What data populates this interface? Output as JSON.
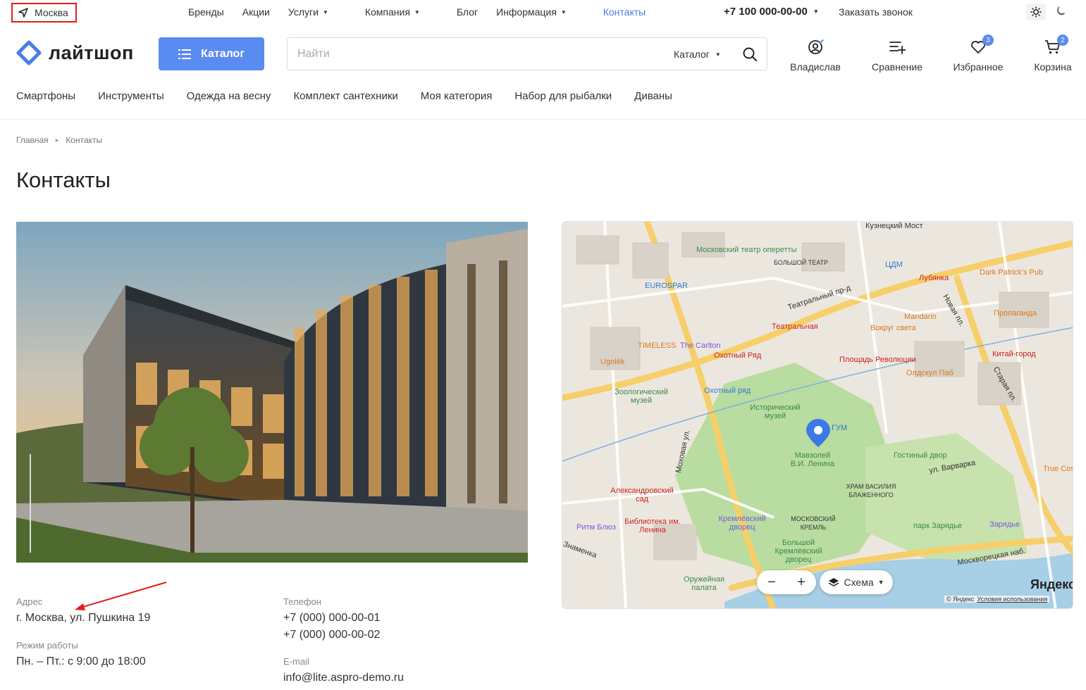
{
  "topbar": {
    "city": "Москва",
    "nav": [
      {
        "label": "Бренды",
        "dropdown": false
      },
      {
        "label": "Акции",
        "dropdown": false
      },
      {
        "label": "Услуги",
        "dropdown": true
      },
      {
        "label": "Компания",
        "dropdown": true
      },
      {
        "label": "Блог",
        "dropdown": false
      },
      {
        "label": "Информация",
        "dropdown": true
      },
      {
        "label": "Контакты",
        "dropdown": false,
        "active": true
      }
    ],
    "phone": "+7 100 000-00-00",
    "callback": "Заказать звонок"
  },
  "header": {
    "logo_text": "лайтшоп",
    "catalog_label": "Каталог",
    "search_placeholder": "Найти",
    "search_scope": "Каталог",
    "actions": [
      {
        "label": "Владислав",
        "icon": "user-icon"
      },
      {
        "label": "Сравнение",
        "icon": "compare-icon"
      },
      {
        "label": "Избранное",
        "icon": "heart-icon",
        "badge": "3"
      },
      {
        "label": "Корзина",
        "icon": "cart-icon",
        "badge": "2"
      }
    ]
  },
  "categories": [
    "Смартфоны",
    "Инструменты",
    "Одежда на весну",
    "Комплект сантехники",
    "Моя категория",
    "Набор для рыбалки",
    "Диваны"
  ],
  "breadcrumb": [
    "Главная",
    "Контакты"
  ],
  "page_title": "Контакты",
  "contacts": {
    "address_label": "Адрес",
    "address": "г. Москва, ул. Пушкина 19",
    "hours_label": "Режим работы",
    "hours": "Пн. – Пт.: с 9:00 до 18:00",
    "phone_label": "Телефон",
    "phones": [
      "+7 (000) 000-00-01",
      "+7 (000) 000-00-02"
    ],
    "email_label": "E-mail",
    "email": "info@lite.aspro-demo.ru"
  },
  "map": {
    "layer_label": "Схема",
    "brand": "Яндекс",
    "copyright": "© Яндекс",
    "terms": "Условия использования",
    "labels": [
      "Кузнецкий Мост",
      "Московский театр оперетты",
      "БОЛЬШОЙ ТЕАТР",
      "ЦДМ",
      "Лубянка",
      "EUROSPAR",
      "Dark Patrick's Pub",
      "Театральный пр-д",
      "Mandarin",
      "Пропаганда",
      "Театральная",
      "Вокруг света",
      "TIMELESS",
      "The Carlton",
      "Охотный Ряд",
      "Площадь Революции",
      "Китай-город",
      "Ugolёk",
      "Зоологический музей",
      "Охотный ряд",
      "Исторический музей",
      "Олдскул Паб",
      "ГУМ",
      "Мавзолей В.И. Ленина",
      "Гостиный двор",
      "ул. Варварка",
      "Александровский сад",
      "Моховая ул.",
      "ХРАМ ВАСИЛИЯ БЛАЖЕННОГО",
      "Ритм Блюз",
      "Библиотека им. Ленина",
      "Кремлёвский дворец",
      "МОСКОВСКИЙ КРЕМЛЬ",
      "парк Зарядье",
      "Зарядье",
      "Большой Кремлёвский дворец",
      "Оружейная палата",
      "Москворецкая наб.",
      "Новая пл.",
      "Старая пл.",
      "Знаменка",
      "True Cost"
    ]
  },
  "colors": {
    "accent": "#5a8bf0",
    "link_active": "#4a7ce8",
    "highlight_box": "#e01e1e",
    "arrow": "#e01e1e"
  }
}
